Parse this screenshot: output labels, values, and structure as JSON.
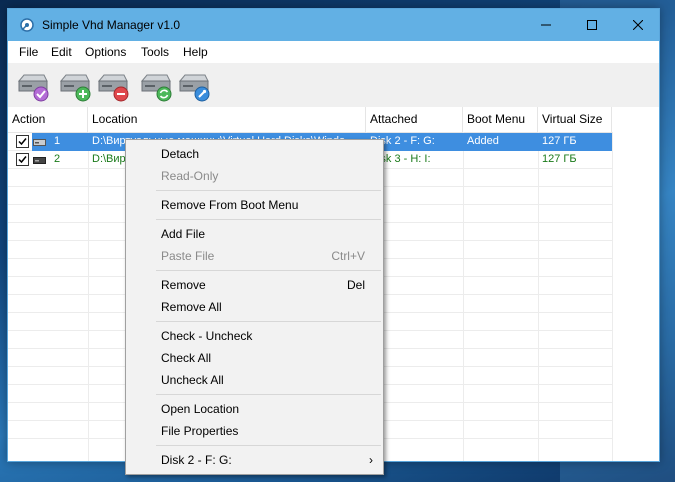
{
  "window": {
    "title": "Simple Vhd Manager v1.0"
  },
  "menu": [
    "File",
    "Edit",
    "Options",
    "Tools",
    "Help"
  ],
  "toolbar": {
    "buttons": [
      "attach-disk",
      "add-disk",
      "remove-disk",
      "refresh-disk",
      "settings-disk"
    ]
  },
  "table": {
    "columns": [
      "Action",
      "Location",
      "Attached",
      "Boot Menu",
      "Virtual Size"
    ],
    "rows": [
      {
        "checked": true,
        "num": "1",
        "location": "D:\\Виртуальные машины\\Virtual Hard Disks\\Windo",
        "attached": "Disk 2  -  F: G:",
        "boot": "Added",
        "size": "127 ГБ"
      },
      {
        "checked": true,
        "num": "2",
        "location": "D:\\Вир",
        "attached": "Disk 3  -  H: I:",
        "boot": "",
        "size": "127 ГБ"
      }
    ]
  },
  "context_menu": {
    "items": [
      {
        "label": "Detach",
        "enabled": true
      },
      {
        "label": "Read-Only",
        "enabled": false
      },
      {
        "label": "Remove From Boot Menu",
        "enabled": true
      },
      {
        "label": "Add File",
        "enabled": true
      },
      {
        "label": "Paste File",
        "enabled": false,
        "shortcut": "Ctrl+V"
      },
      {
        "label": "Remove",
        "enabled": true,
        "shortcut": "Del"
      },
      {
        "label": "Remove All",
        "enabled": true
      },
      {
        "label": "Check - Uncheck",
        "enabled": true
      },
      {
        "label": "Check All",
        "enabled": true
      },
      {
        "label": "Uncheck All",
        "enabled": true
      },
      {
        "label": "Open Location",
        "enabled": true
      },
      {
        "label": "File Properties",
        "enabled": true
      },
      {
        "label": "Disk 2  -  F: G:",
        "enabled": true,
        "submenu": true
      }
    ]
  },
  "colors": {
    "titlebar": "#62b0e4",
    "selection": "#3e8ee0",
    "row_text_green": "#1a7a1a"
  }
}
